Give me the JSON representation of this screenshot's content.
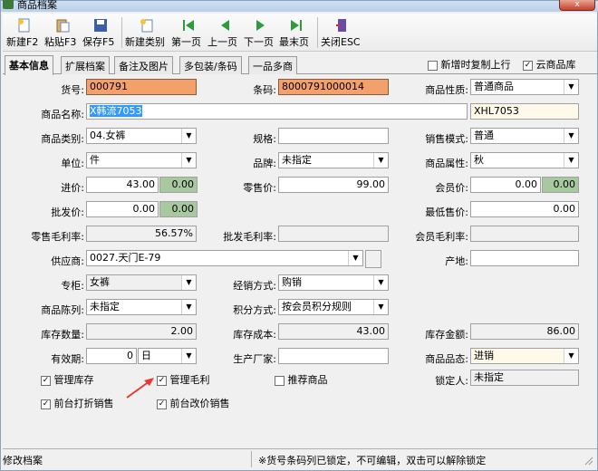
{
  "window": {
    "title": "商品档案",
    "close_symbol": "x"
  },
  "toolbar": {
    "new": "新建F2",
    "paste": "粘贴F3",
    "save": "保存F5",
    "new_category": "新建类别",
    "first": "第一页",
    "prev": "上一页",
    "next": "下一页",
    "last": "最末页",
    "close": "关闭ESC"
  },
  "tabs": [
    "基本信息",
    "扩展档案",
    "备注及图片",
    "多包装/条码",
    "一品多商"
  ],
  "options": {
    "copy_on_new": {
      "label": "新增时复制上行",
      "checked": false
    },
    "cloud_db": {
      "label": "云商品库",
      "checked": true
    }
  },
  "form": {
    "item_no": {
      "label": "货号:",
      "value": "000791"
    },
    "barcode": {
      "label": "条码:",
      "value": "8000791000014"
    },
    "nature": {
      "label": "商品性质:",
      "value": "普通商品"
    },
    "name": {
      "label": "商品名称:",
      "value": "X韩流7053",
      "code": "XHL7053"
    },
    "category": {
      "label": "商品类别:",
      "value": "04.女裤"
    },
    "spec": {
      "label": "规格:",
      "value": ""
    },
    "sales_mode": {
      "label": "销售模式:",
      "value": "普通"
    },
    "unit": {
      "label": "单位:",
      "value": "件"
    },
    "brand": {
      "label": "品牌:",
      "value": "未指定"
    },
    "attribute": {
      "label": "商品属性:",
      "value": "秋"
    },
    "purchase_price": {
      "label": "进价:",
      "value": "43.00",
      "extra": "0.00"
    },
    "retail_price": {
      "label": "零售价:",
      "value": "99.00"
    },
    "member_price": {
      "label": "会员价:",
      "value": "0.00",
      "extra": "0.00"
    },
    "wholesale_price": {
      "label": "批发价:",
      "value": "0.00",
      "extra": "0.00"
    },
    "min_price": {
      "label": "最低售价:",
      "value": "0.00"
    },
    "retail_margin": {
      "label": "零售毛利率:",
      "value": "56.57%"
    },
    "wholesale_margin": {
      "label": "批发毛利率:",
      "value": ""
    },
    "member_margin": {
      "label": "会员毛利率:",
      "value": ""
    },
    "supplier": {
      "label": "供应商:",
      "value": "0027.天门E-79"
    },
    "origin": {
      "label": "产地:",
      "value": ""
    },
    "counter": {
      "label": "专柜:",
      "value": "女裤"
    },
    "operation": {
      "label": "经销方式:",
      "value": "购销"
    },
    "display": {
      "label": "商品陈列:",
      "value": "未指定"
    },
    "points": {
      "label": "积分方式:",
      "value": "按会员积分规则"
    },
    "stock_qty": {
      "label": "库存数量:",
      "value": "2.00"
    },
    "stock_cost": {
      "label": "库存成本:",
      "value": "43.00"
    },
    "stock_amount": {
      "label": "库存金额:",
      "value": "86.00"
    },
    "validity": {
      "label": "有效期:",
      "value": "0",
      "unit": "日"
    },
    "manufacturer": {
      "label": "生产厂家:",
      "value": ""
    },
    "status": {
      "label": "商品品态:",
      "value": "进销"
    },
    "locker": {
      "label": "锁定人:",
      "value": "未指定"
    }
  },
  "checks": {
    "manage_stock": {
      "label": "管理库存",
      "checked": true
    },
    "manage_margin": {
      "label": "管理毛利",
      "checked": true
    },
    "recommend": {
      "label": "推荐商品",
      "checked": false
    },
    "front_discount": {
      "label": "前台打折销售",
      "checked": true
    },
    "front_price_change": {
      "label": "前台改价销售",
      "checked": true
    }
  },
  "status_bar": {
    "left": "修改档案",
    "message": "※货号条码列已锁定，不可编辑，双击可以解除锁定"
  },
  "colors": {
    "locked_field": "#f4a06a",
    "annotation_arrow": "#e8392c",
    "selection": "#3399ff"
  }
}
